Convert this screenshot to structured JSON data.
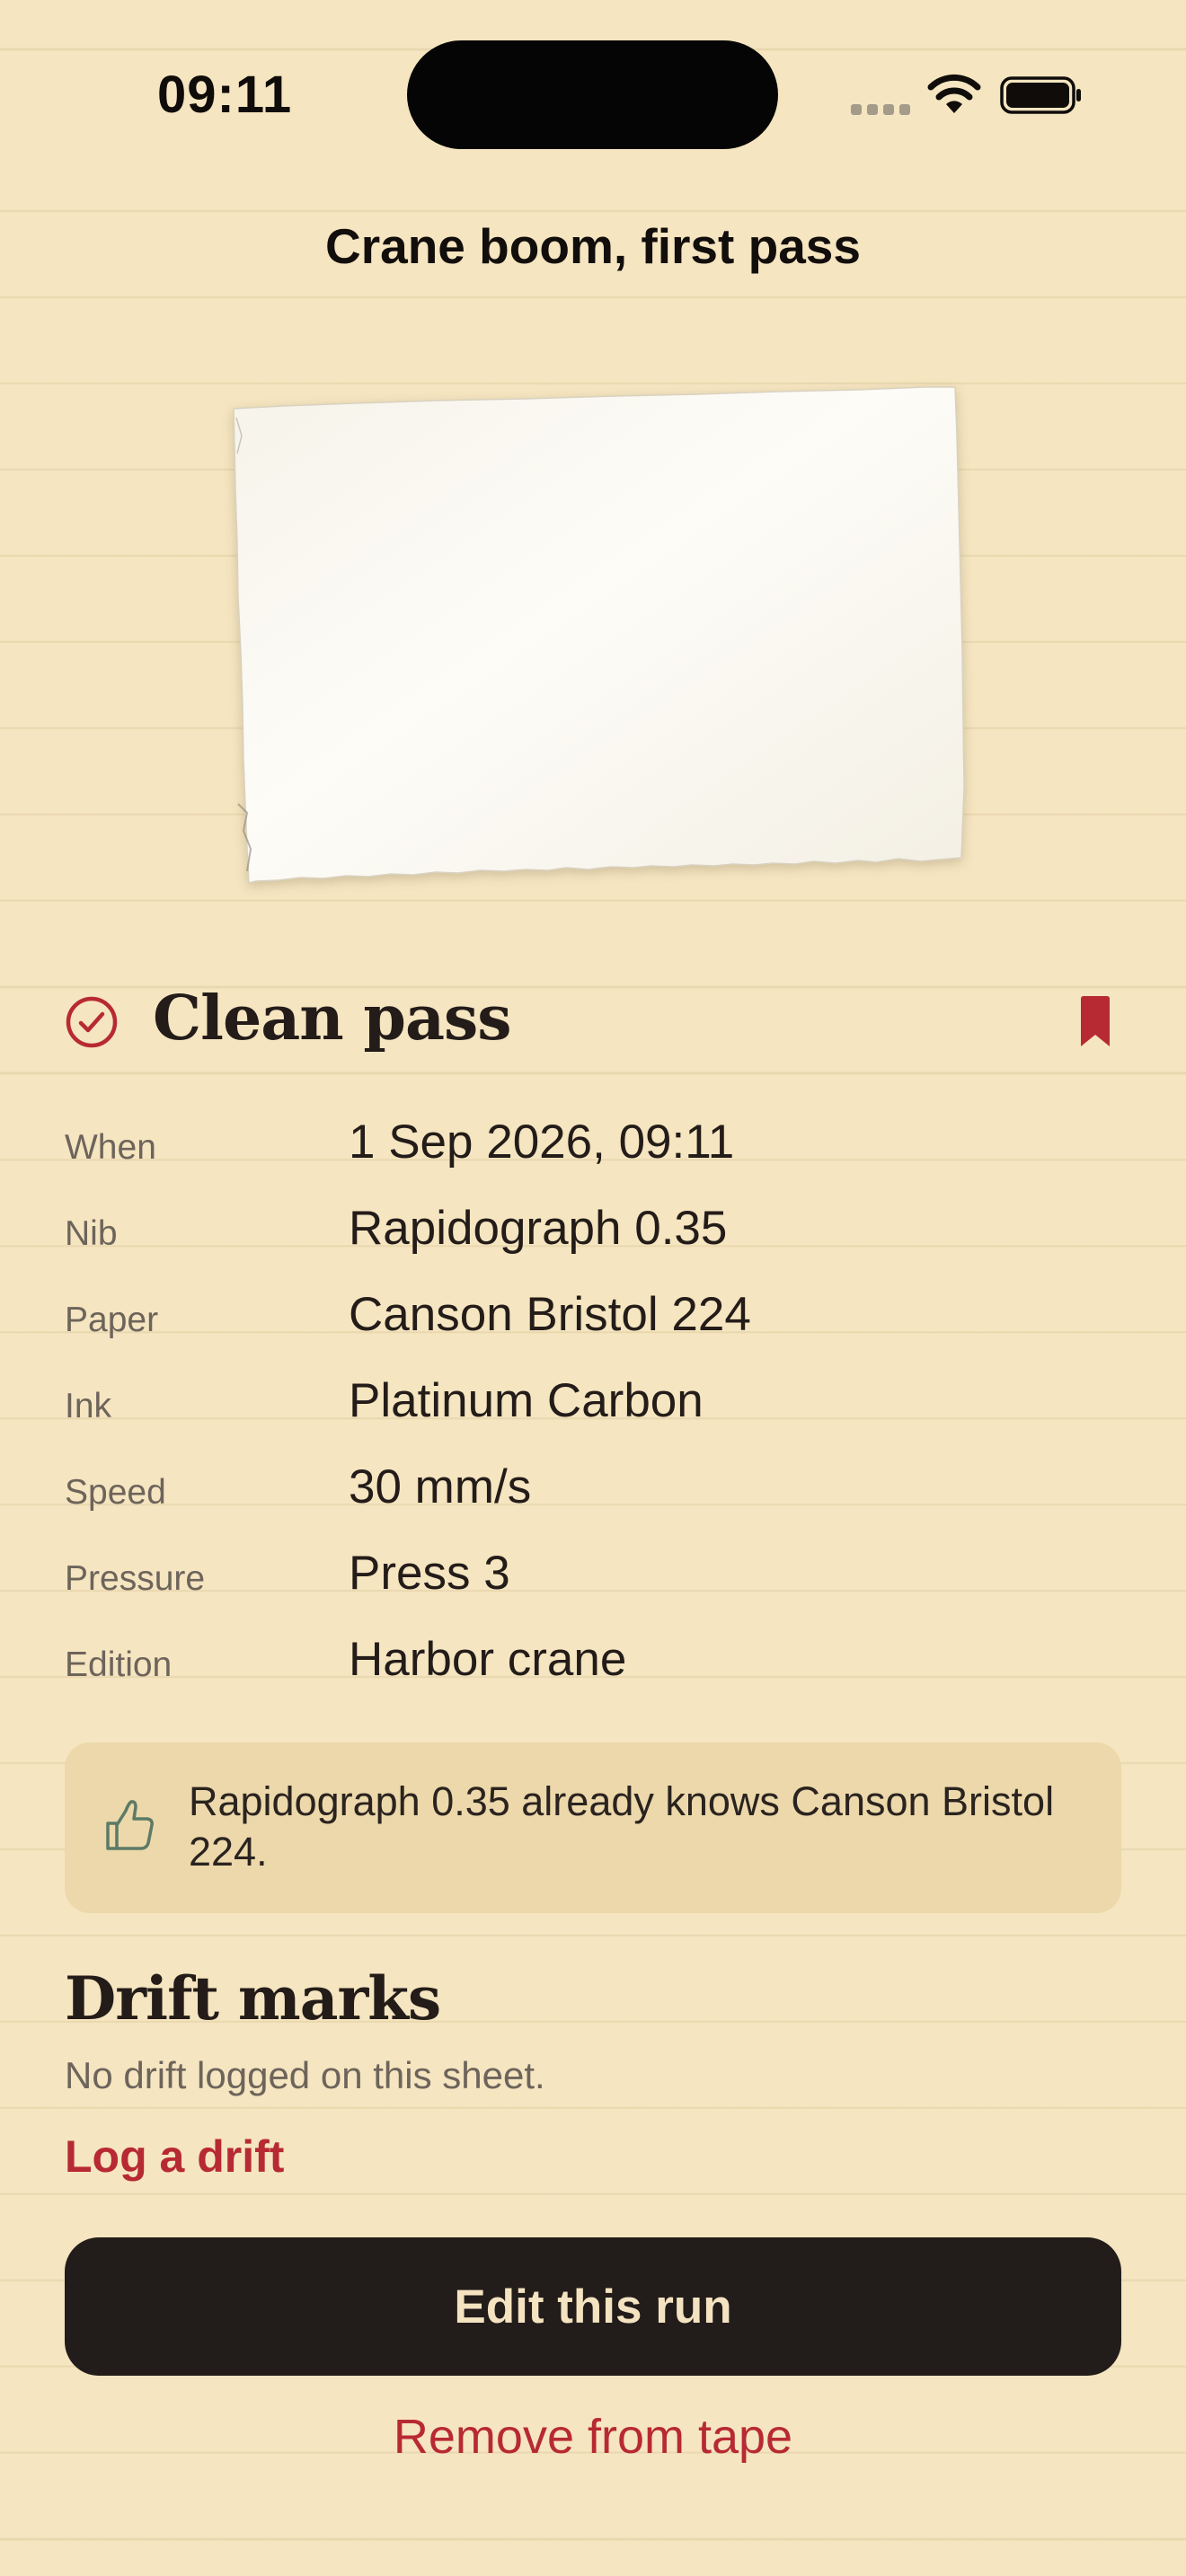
{
  "status_bar": {
    "time": "09:11"
  },
  "header": {
    "title": "Crane boom, first pass"
  },
  "result": {
    "status_icon": "check-circle-icon",
    "title": "Clean pass",
    "bookmark_icon": "bookmark-icon",
    "bookmarked": true
  },
  "details": [
    {
      "label": "When",
      "value": "1 Sep 2026, 09:11"
    },
    {
      "label": "Nib",
      "value": "Rapidograph 0.35"
    },
    {
      "label": "Paper",
      "value": "Canson Bristol 224"
    },
    {
      "label": "Ink",
      "value": "Platinum Carbon"
    },
    {
      "label": "Speed",
      "value": "30 mm/s"
    },
    {
      "label": "Pressure",
      "value": "Press 3"
    },
    {
      "label": "Edition",
      "value": "Harbor crane"
    }
  ],
  "callout": {
    "icon": "thumbs-up-icon",
    "text": "Rapidograph 0.35 already knows Canson Bristol 224."
  },
  "drift": {
    "title": "Drift marks",
    "empty_text": "No drift logged on this sheet.",
    "log_label": "Log a drift"
  },
  "actions": {
    "edit_label": "Edit this run",
    "remove_label": "Remove from tape"
  },
  "colors": {
    "background": "#f5e5c0",
    "accent": "#b72a33",
    "ink": "#231c19",
    "callout": "#ecd8aa",
    "button": "#221c1b"
  }
}
